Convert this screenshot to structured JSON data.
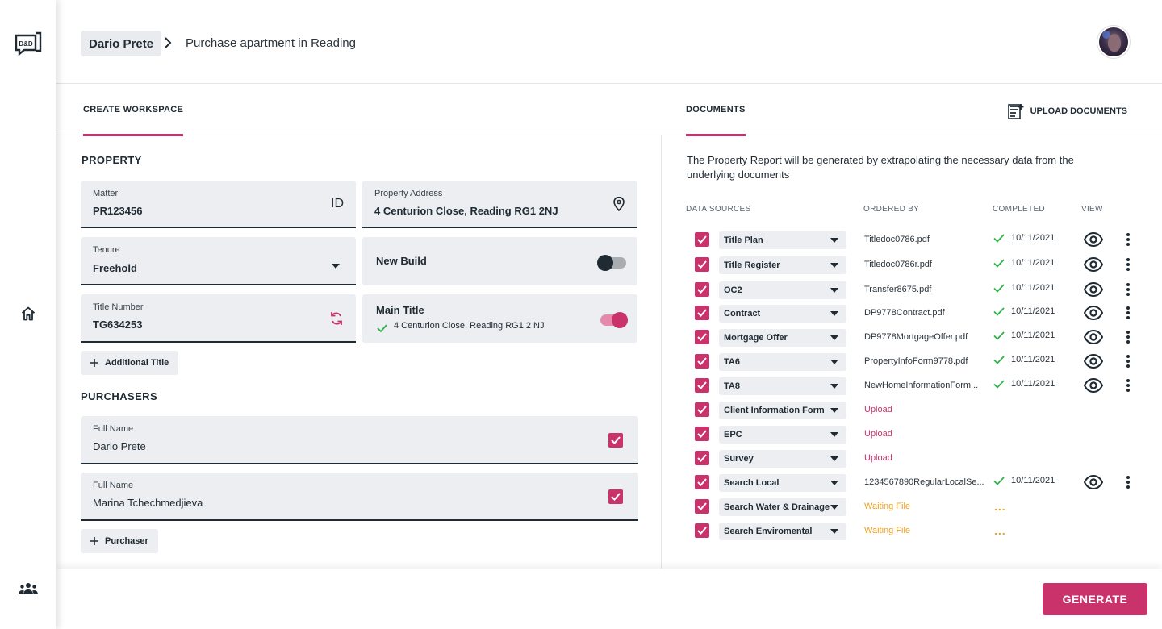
{
  "brand": {
    "logo_text": "D&D",
    "accent": "#c9326a",
    "warning": "#f0a020",
    "success": "#2db34a"
  },
  "header": {
    "breadcrumb_root": "Dario Prete",
    "breadcrumb_current": "Purchase apartment in Reading"
  },
  "tabs": {
    "create_workspace": "CREATE WORKSPACE",
    "documents": "DOCUMENTS",
    "upload_documents": "UPLOAD DOCUMENTS"
  },
  "property": {
    "section_title": "PROPERTY",
    "matter_label": "Matter",
    "matter_value": "PR123456",
    "matter_suffix": "ID",
    "address_label": "Property Address",
    "address_value": "4 Centurion Close, Reading RG1 2NJ",
    "tenure_label": "Tenure",
    "tenure_value": "Freehold",
    "new_build_label": "New Build",
    "new_build_on": false,
    "title_number_label": "Title Number",
    "title_number_value": "TG634253",
    "main_title_label": "Main Title",
    "main_title_value": "4 Centurion Close, Reading RG1 2 NJ",
    "main_title_on": true,
    "additional_title_btn": "Additional Title"
  },
  "purchasers": {
    "section_title": "PURCHASERS",
    "items": [
      {
        "label": "Full Name",
        "value": "Dario Prete",
        "checked": true
      },
      {
        "label": "Full Name",
        "value": "Marina Tchechmedjieva",
        "checked": true
      }
    ],
    "add_btn": "Purchaser"
  },
  "documents": {
    "description": "The Property Report will be generated by extrapolating the necessary data from the underlying documents",
    "columns": {
      "sources": "DATA SOURCES",
      "ordered_by": "ORDERED BY",
      "completed": "COMPLETED",
      "view": "VIEW"
    },
    "rows": [
      {
        "source": "Title Plan",
        "file": "Titledoc0786.pdf",
        "status": "done",
        "date": "10/11/2021"
      },
      {
        "source": "Title Register",
        "file": "Titledoc0786r.pdf",
        "status": "done",
        "date": "10/11/2021"
      },
      {
        "source": "OC2",
        "file": "Transfer8675.pdf",
        "status": "done",
        "date": "10/11/2021"
      },
      {
        "source": "Contract",
        "file": "DP9778Contract.pdf",
        "status": "done",
        "date": "10/11/2021"
      },
      {
        "source": "Mortgage Offer",
        "file": "DP9778MortgageOffer.pdf",
        "status": "done",
        "date": "10/11/2021"
      },
      {
        "source": "TA6",
        "file": "PropertyInfoForm9778.pdf",
        "status": "done",
        "date": "10/11/2021"
      },
      {
        "source": "TA8",
        "file": "NewHomeInformationForm...",
        "status": "done",
        "date": "10/11/2021"
      },
      {
        "source": "Client Information Form",
        "file": "Upload",
        "status": "upload",
        "date": ""
      },
      {
        "source": "EPC",
        "file": "Upload",
        "status": "upload",
        "date": ""
      },
      {
        "source": "Survey",
        "file": "Upload",
        "status": "upload",
        "date": ""
      },
      {
        "source": "Search Local",
        "file": "1234567890RegularLocalSe...",
        "status": "done",
        "date": "10/11/2021"
      },
      {
        "source": "Search Water & Drainage",
        "file": "Waiting File",
        "status": "waiting",
        "date": "..."
      },
      {
        "source": "Search Enviromental",
        "file": "Waiting File",
        "status": "waiting",
        "date": "..."
      }
    ]
  },
  "footer": {
    "generate_btn": "GENERATE"
  }
}
